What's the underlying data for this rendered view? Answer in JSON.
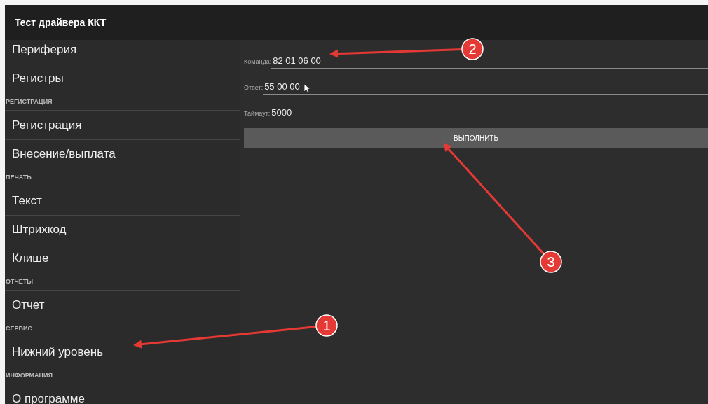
{
  "window": {
    "title": "Тест драйвера ККТ"
  },
  "sidebar": {
    "items": [
      {
        "kind": "item",
        "label": "Периферия"
      },
      {
        "kind": "item",
        "label": "Регистры"
      },
      {
        "kind": "header",
        "label": "РЕГИСТРАЦИЯ"
      },
      {
        "kind": "item",
        "label": "Регистрация"
      },
      {
        "kind": "item",
        "label": "Внесение/выплата"
      },
      {
        "kind": "header",
        "label": "ПЕЧАТЬ"
      },
      {
        "kind": "item",
        "label": "Текст"
      },
      {
        "kind": "item",
        "label": "Штрихкод"
      },
      {
        "kind": "item",
        "label": "Клише"
      },
      {
        "kind": "header",
        "label": "ОТЧЕТЫ"
      },
      {
        "kind": "item",
        "label": "Отчет"
      },
      {
        "kind": "header",
        "label": "СЕРВИС"
      },
      {
        "kind": "item",
        "label": "Нижний уровень"
      },
      {
        "kind": "header",
        "label": "ИНФОРМАЦИЯ"
      },
      {
        "kind": "item",
        "label": "О программе"
      }
    ]
  },
  "form": {
    "fields": [
      {
        "label": "Команда:",
        "value": "82 01 06 00"
      },
      {
        "label": "Ответ:",
        "value": "55 00 00"
      },
      {
        "label": "Таймаут:",
        "value": "5000"
      }
    ],
    "button": "ВЫПОЛНИТЬ"
  },
  "annotations": [
    {
      "number": "1"
    },
    {
      "number": "2"
    },
    {
      "number": "3"
    }
  ]
}
